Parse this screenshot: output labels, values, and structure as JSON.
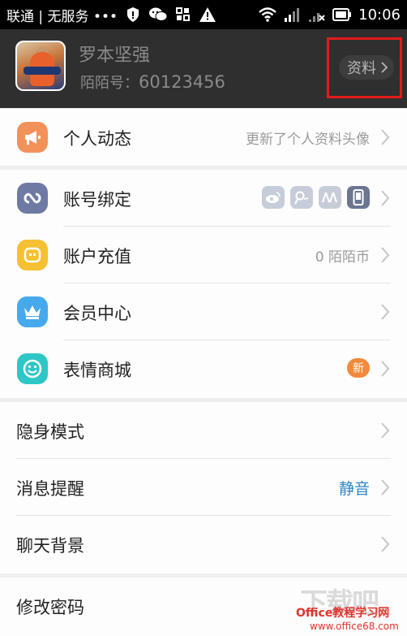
{
  "status_bar": {
    "carrier": "联通 | 无服务 •••",
    "time": "10:06"
  },
  "profile": {
    "name": "罗本坚强",
    "id_label": "陌陌号：",
    "id_value": "60123456",
    "profile_button": "资料"
  },
  "menu_top": [
    {
      "label": "个人动态",
      "value": "更新了个人资料头像",
      "icon": "megaphone-icon",
      "color": "#f2925a"
    }
  ],
  "menu_account": [
    {
      "label": "账号绑定",
      "icon": "link-icon",
      "color": "#6e7aa3",
      "bind_icons": [
        "weibo-icon",
        "qq-weibo-icon",
        "renren-icon",
        "phone-icon"
      ]
    },
    {
      "label": "账户充值",
      "value": "0 陌陌币",
      "icon": "coin-icon",
      "color": "#f6c033"
    },
    {
      "label": "会员中心",
      "icon": "crown-icon",
      "color": "#46a9ec"
    },
    {
      "label": "表情商城",
      "badge": "新",
      "icon": "smiley-icon",
      "color": "#2fc6c6"
    }
  ],
  "menu_settings": [
    {
      "label": "隐身模式"
    },
    {
      "label": "消息提醒",
      "value": "静音"
    },
    {
      "label": "聊天背景"
    }
  ],
  "menu_bottom": [
    {
      "label": "修改密码"
    }
  ],
  "watermark": {
    "logo": "下载吧",
    "line1": "Office教程学习网",
    "line2": "www.office68.com"
  }
}
